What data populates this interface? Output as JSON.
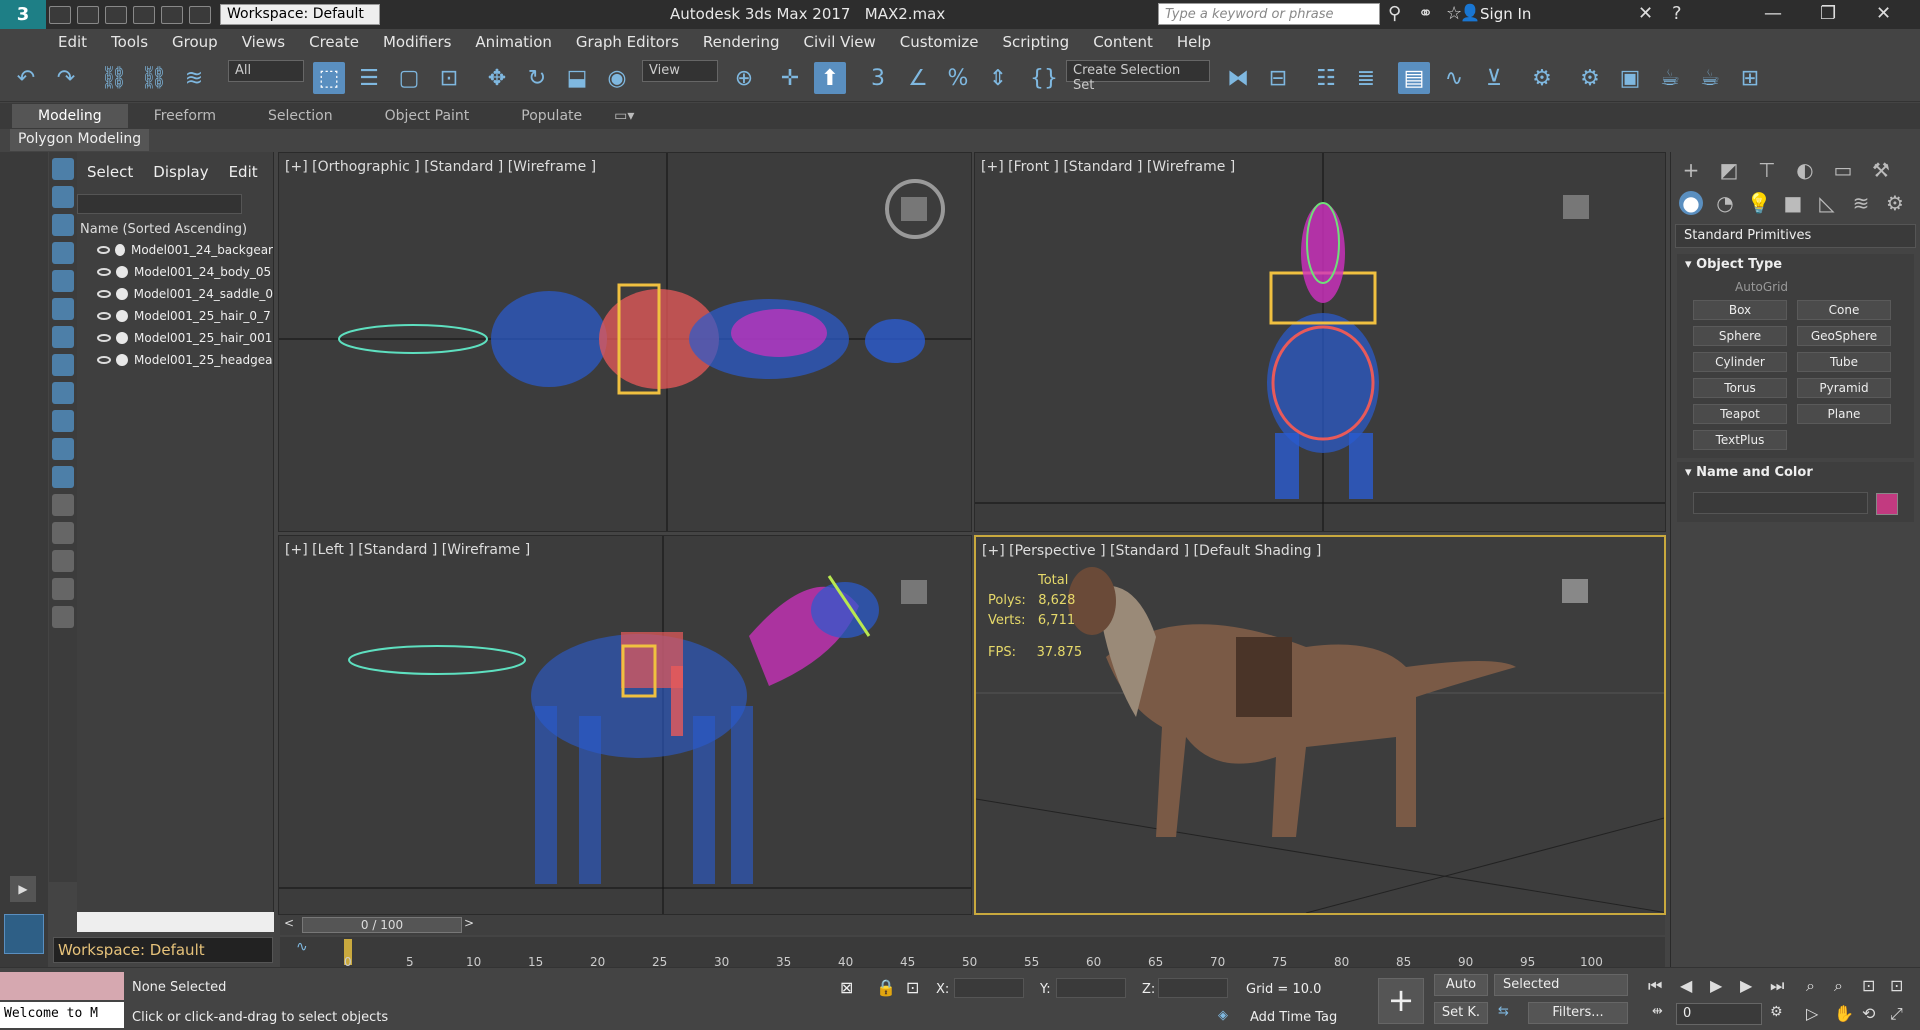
{
  "titlebar": {
    "app_title": "Autodesk 3ds Max 2017",
    "file_name": "MAX2.max",
    "workspace": "Workspace: Default",
    "search_placeholder": "Type a keyword or phrase",
    "sign_in": "Sign In",
    "logo": "3"
  },
  "menu": [
    "Edit",
    "Tools",
    "Group",
    "Views",
    "Create",
    "Modifiers",
    "Animation",
    "Graph Editors",
    "Rendering",
    "Civil View",
    "Customize",
    "Scripting",
    "Content",
    "Help"
  ],
  "toolbar": {
    "filter": "All",
    "ref_coord": "View",
    "selection_set": "Create Selection Set"
  },
  "ribbon": {
    "tabs": [
      "Modeling",
      "Freeform",
      "Selection",
      "Object Paint",
      "Populate"
    ],
    "active_tab": "Modeling",
    "panel": "Polygon Modeling"
  },
  "scene_explorer": {
    "tabs": [
      "Select",
      "Display",
      "Edit"
    ],
    "header": "Name (Sorted Ascending)",
    "rows": [
      "Model001_24_backgear",
      "Model001_24_body_05",
      "Model001_24_saddle_0",
      "Model001_25_hair_0_7",
      "Model001_25_hair_001",
      "Model001_25_headgea"
    ]
  },
  "viewports": {
    "top_left": "[+] [Orthographic ] [Standard ] [Wireframe ]",
    "top_right": "[+] [Front ] [Standard ] [Wireframe ]",
    "bottom_left": "[+] [Left ] [Standard ] [Wireframe ]",
    "bottom_right": "[+] [Perspective ] [Standard ] [Default Shading ]",
    "stats": {
      "total_label": "Total",
      "polys_label": "Polys:",
      "polys": "8,628",
      "verts_label": "Verts:",
      "verts": "6,711",
      "fps_label": "FPS:",
      "fps": "37.875"
    }
  },
  "time": {
    "slider": "0 / 100",
    "ticks": [
      "0",
      "5",
      "10",
      "15",
      "20",
      "25",
      "30",
      "35",
      "40",
      "45",
      "50",
      "55",
      "60",
      "65",
      "70",
      "75",
      "80",
      "85",
      "90",
      "95",
      "100"
    ]
  },
  "command_panel": {
    "dropdown": "Standard Primitives",
    "object_type": "Object Type",
    "autogrid": "AutoGrid",
    "primitives": [
      "Box",
      "Cone",
      "Sphere",
      "GeoSphere",
      "Cylinder",
      "Tube",
      "Torus",
      "Pyramid",
      "Teapot",
      "Plane",
      "TextPlus"
    ],
    "name_and_color": "Name and Color",
    "object_color": "#c23a80"
  },
  "status": {
    "selection": "None Selected",
    "prompt": "Click or click-and-drag to select objects",
    "welcome": "Welcome to M",
    "x_label": "X:",
    "y_label": "Y:",
    "z_label": "Z:",
    "grid": "Grid = 10.0",
    "add_time_tag": "Add Time Tag",
    "auto_key": "Auto",
    "set_key": "Set K.",
    "key_mode": "Selected",
    "filters": "Filters...",
    "frame": "0"
  }
}
